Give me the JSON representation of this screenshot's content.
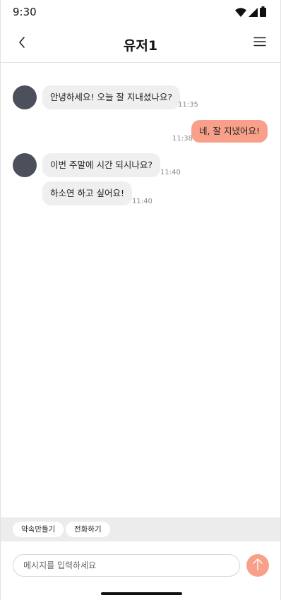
{
  "status_bar": {
    "time": "9:30",
    "icons": [
      "wifi-icon",
      "signal-icon",
      "battery-icon"
    ]
  },
  "header": {
    "back_icon": "chevron-left-icon",
    "title": "유저1",
    "menu_icon": "hamburger-menu-icon"
  },
  "messages": [
    {
      "sender": "other",
      "text": "안녕하세요! 오늘 잘 지내셨나요?",
      "time": "11:35"
    },
    {
      "sender": "me",
      "text": "네, 잘 지냈어요!",
      "time": "11:38"
    },
    {
      "sender": "other",
      "text": "이번 주말에 시간 되시나요?",
      "time": "11:40"
    },
    {
      "sender": "other",
      "text": "하소연 하고 싶어요!",
      "time": "11:40"
    }
  ],
  "quick_actions": [
    {
      "label": "약속만들기"
    },
    {
      "label": "전화하기"
    }
  ],
  "composer": {
    "placeholder": "메시지를 입력하세요",
    "value": "",
    "send_icon": "arrow-up-icon"
  },
  "colors": {
    "accent": "#f8a08a",
    "incoming_bubble": "#efefef",
    "avatar": "#4b505c",
    "quick_bar_bg": "#ececec"
  }
}
